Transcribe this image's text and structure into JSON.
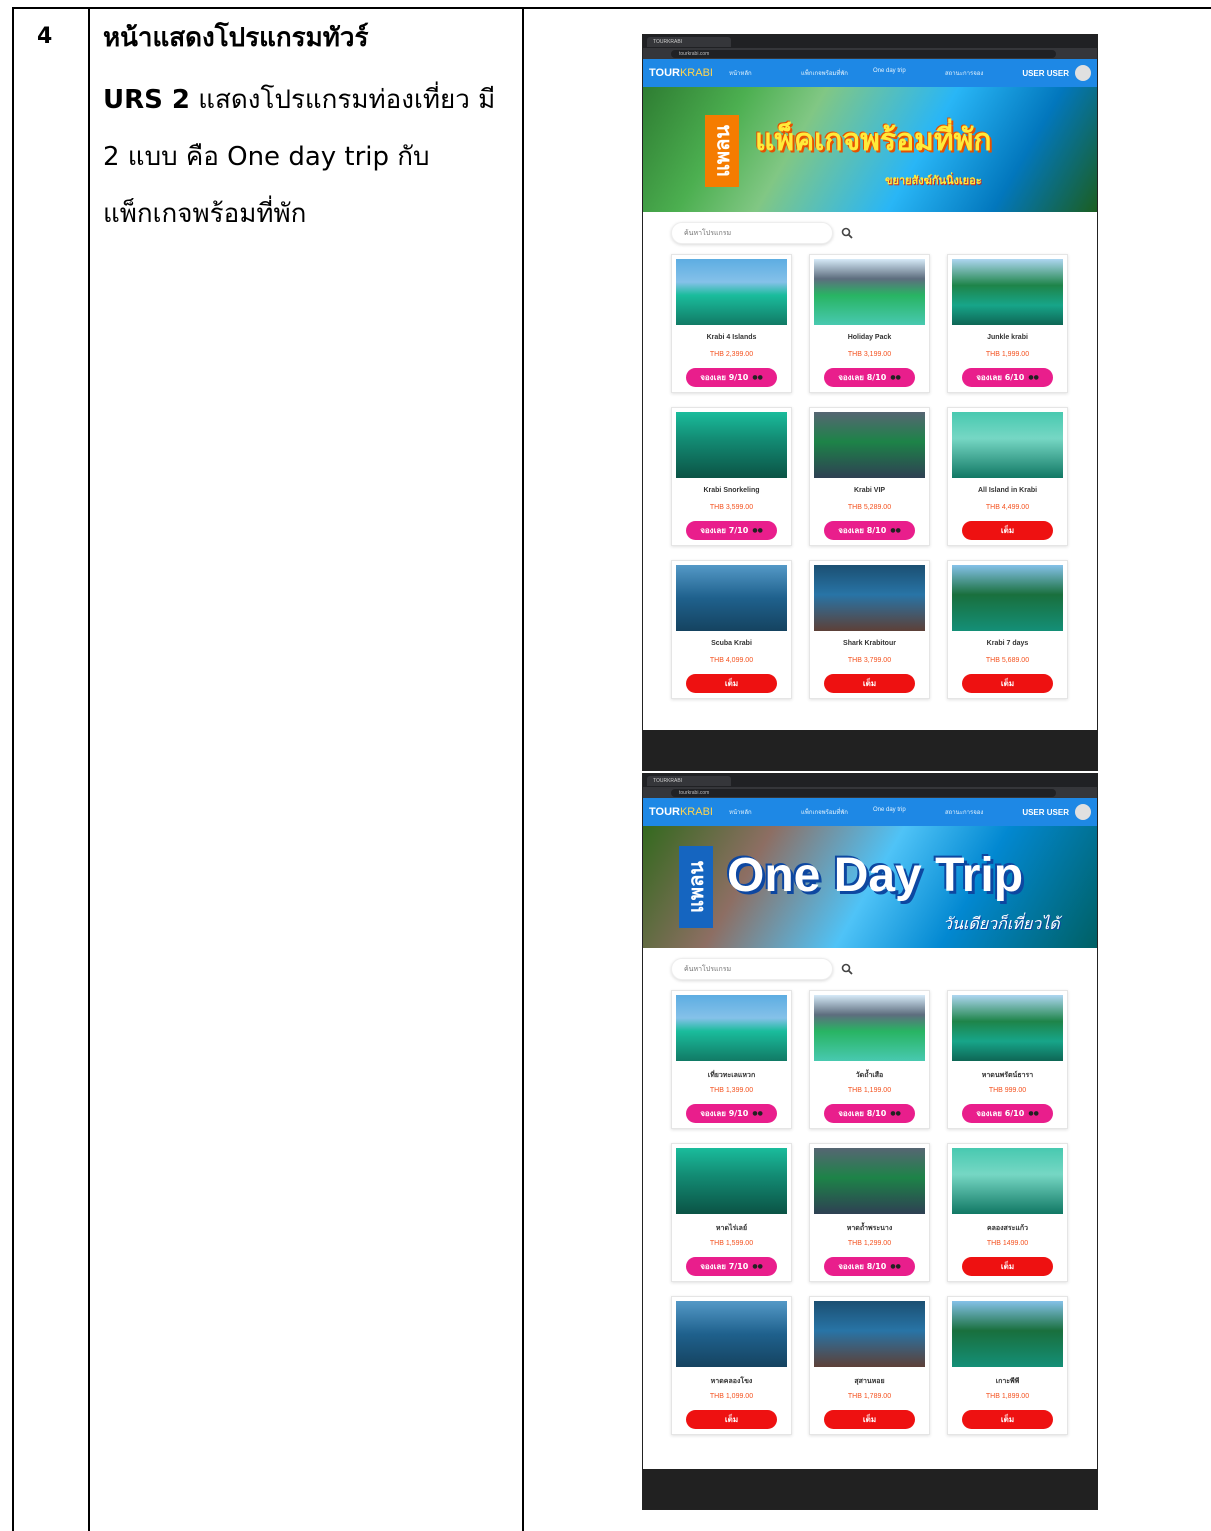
{
  "row": {
    "number": "4",
    "title": "หน้าแสดงโปรแกรมทัวร์",
    "urs_id": "URS 2",
    "desc_line1": " แสดงโปรแกรมท่องเที่ยว มี",
    "desc_line2": "2 แบบ คือ One day trip กับ",
    "desc_line3": "แพ็กเกจพร้อมที่พัก"
  },
  "shot1": {
    "tab": "TOURKRABI",
    "url": "tourkrabi.com",
    "nav": {
      "logo_a": "TOUR",
      "logo_b": "KRABI",
      "links": [
        "หน้าหลัก",
        "แพ็กเกจพร้อมที่พัก",
        "One day trip",
        "สถานะการจอง"
      ],
      "user": "USER USER"
    },
    "banner": {
      "plan": "แพลน",
      "headline": "แพ็คเกจพร้อมที่พัก",
      "sub": "ขยายสังฆ์กันนิ่งเยอะ"
    },
    "search_placeholder": "ค้นหาโปรแกรม",
    "cards": [
      {
        "name": "Krabi 4 Islands",
        "price": "THB 2,399.00",
        "btn": "จองเลย  9/10",
        "status": "book"
      },
      {
        "name": "Holiday Pack",
        "price": "THB 3,199.00",
        "btn": "จองเลย  8/10",
        "status": "book"
      },
      {
        "name": "Junkle krabi",
        "price": "THB 1,999.00",
        "btn": "จองเลย  6/10",
        "status": "book"
      },
      {
        "name": "Krabi Snorkeling",
        "price": "THB 3,599.00",
        "btn": "จองเลย  7/10",
        "status": "book"
      },
      {
        "name": "Krabi VIP",
        "price": "THB 5,289.00",
        "btn": "จองเลย  8/10",
        "status": "book"
      },
      {
        "name": "All Island in Krabi",
        "price": "THB 4,499.00",
        "btn": "เต็ม",
        "status": "full"
      },
      {
        "name": "Scuba Krabi",
        "price": "THB 4,099.00",
        "btn": "เต็ม",
        "status": "full"
      },
      {
        "name": "Shark Krabitour",
        "price": "THB 3,799.00",
        "btn": "เต็ม",
        "status": "full"
      },
      {
        "name": "Krabi 7 days",
        "price": "THB 5,689.00",
        "btn": "เต็ม",
        "status": "full"
      }
    ]
  },
  "shot2": {
    "tab": "TOURKRABI",
    "url": "tourkrabi.com",
    "nav": {
      "logo_a": "TOUR",
      "logo_b": "KRABI",
      "links": [
        "หน้าหลัก",
        "แพ็กเกจพร้อมที่พัก",
        "One day trip",
        "สถานะการจอง"
      ],
      "user": "USER USER"
    },
    "banner": {
      "plan": "แพลน",
      "headline": "One Day Trip",
      "sub": "วันเดียวก็เที่ยวได้"
    },
    "search_placeholder": "ค้นหาโปรแกรม",
    "cards": [
      {
        "name": "เที่ยวทะเลแหวก",
        "price": "THB 1,399.00",
        "btn": "จองเลย  9/10",
        "status": "book"
      },
      {
        "name": "วัดถ้ำเสือ",
        "price": "THB 1,199.00",
        "btn": "จองเลย  8/10",
        "status": "book"
      },
      {
        "name": "หาดนพรัตน์ธารา",
        "price": "THB 999.00",
        "btn": "จองเลย  6/10",
        "status": "book"
      },
      {
        "name": "หาดไร่เลย์",
        "price": "THB 1,599.00",
        "btn": "จองเลย  7/10",
        "status": "book"
      },
      {
        "name": "หาดถ้ำพระนาง",
        "price": "THB 1,299.00",
        "btn": "จองเลย  8/10",
        "status": "book"
      },
      {
        "name": "คลองสระแก้ว",
        "price": "THB 1499.00",
        "btn": "เต็ม",
        "status": "full"
      },
      {
        "name": "หาดคลองโขง",
        "price": "THB 1,099.00",
        "btn": "เต็ม",
        "status": "full"
      },
      {
        "name": "สุสานหอย",
        "price": "THB 1,789.00",
        "btn": "เต็ม",
        "status": "full"
      },
      {
        "name": "เกาะพีพี",
        "price": "THB 1,899.00",
        "btn": "เต็ม",
        "status": "full"
      }
    ]
  }
}
